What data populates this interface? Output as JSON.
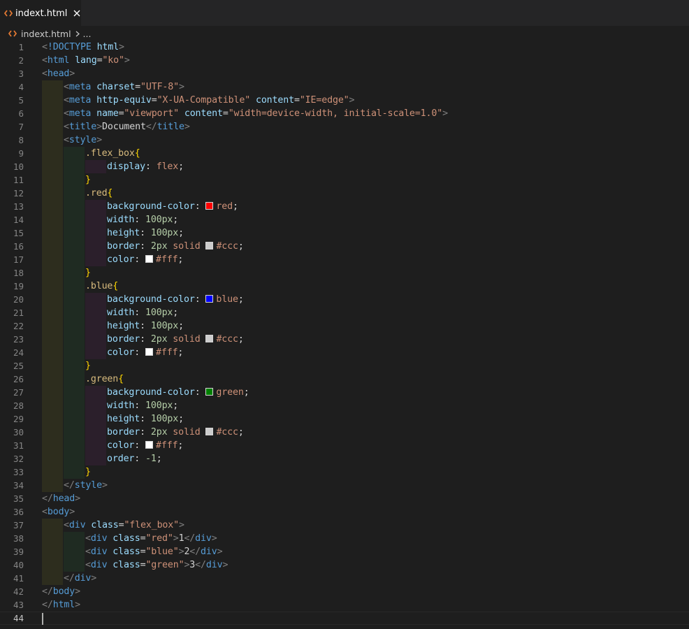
{
  "tab": {
    "label": "indext.html",
    "close_glyph": "✕",
    "icon": "html-file-icon"
  },
  "breadcrumb": {
    "file": "indext.html",
    "more": "..."
  },
  "colors": {
    "red": "#ff0000",
    "blue": "#0000ff",
    "green": "#008000",
    "ccc": "#cccccc",
    "fff": "#ffffff"
  },
  "editor": {
    "active_line": 44,
    "lines": [
      [
        [
          "punc",
          "<"
        ],
        [
          "tag",
          "!DOCTYPE"
        ],
        [
          "text",
          " "
        ],
        [
          "attr",
          "html"
        ],
        [
          "punc",
          ">"
        ]
      ],
      [
        [
          "punc",
          "<"
        ],
        [
          "tag",
          "html"
        ],
        [
          "text",
          " "
        ],
        [
          "attr",
          "lang"
        ],
        [
          "text",
          "="
        ],
        [
          "str",
          "\"ko\""
        ],
        [
          "punc",
          ">"
        ]
      ],
      [
        [
          "punc",
          "<"
        ],
        [
          "tag",
          "head"
        ],
        [
          "punc",
          ">"
        ]
      ],
      [
        [
          "punc",
          "<"
        ],
        [
          "tag",
          "meta"
        ],
        [
          "text",
          " "
        ],
        [
          "attr",
          "charset"
        ],
        [
          "text",
          "="
        ],
        [
          "str",
          "\"UTF-8\""
        ],
        [
          "punc",
          ">"
        ]
      ],
      [
        [
          "punc",
          "<"
        ],
        [
          "tag",
          "meta"
        ],
        [
          "text",
          " "
        ],
        [
          "attr",
          "http-equiv"
        ],
        [
          "text",
          "="
        ],
        [
          "str",
          "\"X-UA-Compatible\""
        ],
        [
          "text",
          " "
        ],
        [
          "attr",
          "content"
        ],
        [
          "text",
          "="
        ],
        [
          "str",
          "\"IE=edge\""
        ],
        [
          "punc",
          ">"
        ]
      ],
      [
        [
          "punc",
          "<"
        ],
        [
          "tag",
          "meta"
        ],
        [
          "text",
          " "
        ],
        [
          "attr",
          "name"
        ],
        [
          "text",
          "="
        ],
        [
          "str",
          "\"viewport\""
        ],
        [
          "text",
          " "
        ],
        [
          "attr",
          "content"
        ],
        [
          "text",
          "="
        ],
        [
          "str",
          "\"width=device-width, initial-scale=1.0\""
        ],
        [
          "punc",
          ">"
        ]
      ],
      [
        [
          "punc",
          "<"
        ],
        [
          "tag",
          "title"
        ],
        [
          "punc",
          ">"
        ],
        [
          "text",
          "Document"
        ],
        [
          "punc",
          "</"
        ],
        [
          "tag",
          "title"
        ],
        [
          "punc",
          ">"
        ]
      ],
      [
        [
          "punc",
          "<"
        ],
        [
          "tag",
          "style"
        ],
        [
          "punc",
          ">"
        ]
      ],
      [
        [
          "sel",
          ".flex_box"
        ],
        [
          "brace",
          "{"
        ]
      ],
      [
        [
          "prop",
          "display"
        ],
        [
          "text",
          ": "
        ],
        [
          "val",
          "flex"
        ],
        [
          "text",
          ";"
        ]
      ],
      [
        [
          "brace",
          "}"
        ]
      ],
      [
        [
          "sel",
          ".red"
        ],
        [
          "brace",
          "{"
        ]
      ],
      [
        [
          "prop",
          "background-color"
        ],
        [
          "text",
          ": "
        ],
        [
          "swatch",
          "red"
        ],
        [
          "val",
          "red"
        ],
        [
          "text",
          ";"
        ]
      ],
      [
        [
          "prop",
          "width"
        ],
        [
          "text",
          ": "
        ],
        [
          "num",
          "100px"
        ],
        [
          "text",
          ";"
        ]
      ],
      [
        [
          "prop",
          "height"
        ],
        [
          "text",
          ": "
        ],
        [
          "num",
          "100px"
        ],
        [
          "text",
          ";"
        ]
      ],
      [
        [
          "prop",
          "border"
        ],
        [
          "text",
          ": "
        ],
        [
          "num",
          "2px"
        ],
        [
          "text",
          " "
        ],
        [
          "val",
          "solid"
        ],
        [
          "text",
          " "
        ],
        [
          "swatch",
          "ccc"
        ],
        [
          "val",
          "#ccc"
        ],
        [
          "text",
          ";"
        ]
      ],
      [
        [
          "prop",
          "color"
        ],
        [
          "text",
          ": "
        ],
        [
          "swatch",
          "fff"
        ],
        [
          "val",
          "#fff"
        ],
        [
          "text",
          ";"
        ]
      ],
      [
        [
          "brace",
          "}"
        ]
      ],
      [
        [
          "sel",
          ".blue"
        ],
        [
          "brace",
          "{"
        ]
      ],
      [
        [
          "prop",
          "background-color"
        ],
        [
          "text",
          ": "
        ],
        [
          "swatch",
          "blue"
        ],
        [
          "val",
          "blue"
        ],
        [
          "text",
          ";"
        ]
      ],
      [
        [
          "prop",
          "width"
        ],
        [
          "text",
          ": "
        ],
        [
          "num",
          "100px"
        ],
        [
          "text",
          ";"
        ]
      ],
      [
        [
          "prop",
          "height"
        ],
        [
          "text",
          ": "
        ],
        [
          "num",
          "100px"
        ],
        [
          "text",
          ";"
        ]
      ],
      [
        [
          "prop",
          "border"
        ],
        [
          "text",
          ": "
        ],
        [
          "num",
          "2px"
        ],
        [
          "text",
          " "
        ],
        [
          "val",
          "solid"
        ],
        [
          "text",
          " "
        ],
        [
          "swatch",
          "ccc"
        ],
        [
          "val",
          "#ccc"
        ],
        [
          "text",
          ";"
        ]
      ],
      [
        [
          "prop",
          "color"
        ],
        [
          "text",
          ": "
        ],
        [
          "swatch",
          "fff"
        ],
        [
          "val",
          "#fff"
        ],
        [
          "text",
          ";"
        ]
      ],
      [
        [
          "brace",
          "}"
        ]
      ],
      [
        [
          "sel",
          ".green"
        ],
        [
          "brace",
          "{"
        ]
      ],
      [
        [
          "prop",
          "background-color"
        ],
        [
          "text",
          ": "
        ],
        [
          "swatch",
          "green"
        ],
        [
          "val",
          "green"
        ],
        [
          "text",
          ";"
        ]
      ],
      [
        [
          "prop",
          "width"
        ],
        [
          "text",
          ": "
        ],
        [
          "num",
          "100px"
        ],
        [
          "text",
          ";"
        ]
      ],
      [
        [
          "prop",
          "height"
        ],
        [
          "text",
          ": "
        ],
        [
          "num",
          "100px"
        ],
        [
          "text",
          ";"
        ]
      ],
      [
        [
          "prop",
          "border"
        ],
        [
          "text",
          ": "
        ],
        [
          "num",
          "2px"
        ],
        [
          "text",
          " "
        ],
        [
          "val",
          "solid"
        ],
        [
          "text",
          " "
        ],
        [
          "swatch",
          "ccc"
        ],
        [
          "val",
          "#ccc"
        ],
        [
          "text",
          ";"
        ]
      ],
      [
        [
          "prop",
          "color"
        ],
        [
          "text",
          ": "
        ],
        [
          "swatch",
          "fff"
        ],
        [
          "val",
          "#fff"
        ],
        [
          "text",
          ";"
        ]
      ],
      [
        [
          "prop",
          "order"
        ],
        [
          "text",
          ": "
        ],
        [
          "num",
          "-1"
        ],
        [
          "text",
          ";"
        ]
      ],
      [
        [
          "brace",
          "}"
        ]
      ],
      [
        [
          "punc",
          "</"
        ],
        [
          "tag",
          "style"
        ],
        [
          "punc",
          ">"
        ]
      ],
      [
        [
          "punc",
          "</"
        ],
        [
          "tag",
          "head"
        ],
        [
          "punc",
          ">"
        ]
      ],
      [
        [
          "punc",
          "<"
        ],
        [
          "tag",
          "body"
        ],
        [
          "punc",
          ">"
        ]
      ],
      [
        [
          "punc",
          "<"
        ],
        [
          "tag",
          "div"
        ],
        [
          "text",
          " "
        ],
        [
          "attr",
          "class"
        ],
        [
          "text",
          "="
        ],
        [
          "str",
          "\"flex_box\""
        ],
        [
          "punc",
          ">"
        ]
      ],
      [
        [
          "punc",
          "<"
        ],
        [
          "tag",
          "div"
        ],
        [
          "text",
          " "
        ],
        [
          "attr",
          "class"
        ],
        [
          "text",
          "="
        ],
        [
          "str",
          "\"red\""
        ],
        [
          "punc",
          ">"
        ],
        [
          "text",
          "1"
        ],
        [
          "punc",
          "</"
        ],
        [
          "tag",
          "div"
        ],
        [
          "punc",
          ">"
        ]
      ],
      [
        [
          "punc",
          "<"
        ],
        [
          "tag",
          "div"
        ],
        [
          "text",
          " "
        ],
        [
          "attr",
          "class"
        ],
        [
          "text",
          "="
        ],
        [
          "str",
          "\"blue\""
        ],
        [
          "punc",
          ">"
        ],
        [
          "text",
          "2"
        ],
        [
          "punc",
          "</"
        ],
        [
          "tag",
          "div"
        ],
        [
          "punc",
          ">"
        ]
      ],
      [
        [
          "punc",
          "<"
        ],
        [
          "tag",
          "div"
        ],
        [
          "text",
          " "
        ],
        [
          "attr",
          "class"
        ],
        [
          "text",
          "="
        ],
        [
          "str",
          "\"green\""
        ],
        [
          "punc",
          ">"
        ],
        [
          "text",
          "3"
        ],
        [
          "punc",
          "</"
        ],
        [
          "tag",
          "div"
        ],
        [
          "punc",
          ">"
        ]
      ],
      [
        [
          "punc",
          "</"
        ],
        [
          "tag",
          "div"
        ],
        [
          "punc",
          ">"
        ]
      ],
      [
        [
          "punc",
          "</"
        ],
        [
          "tag",
          "body"
        ],
        [
          "punc",
          ">"
        ]
      ],
      [
        [
          "punc",
          "</"
        ],
        [
          "tag",
          "html"
        ],
        [
          "punc",
          ">"
        ]
      ],
      []
    ]
  }
}
